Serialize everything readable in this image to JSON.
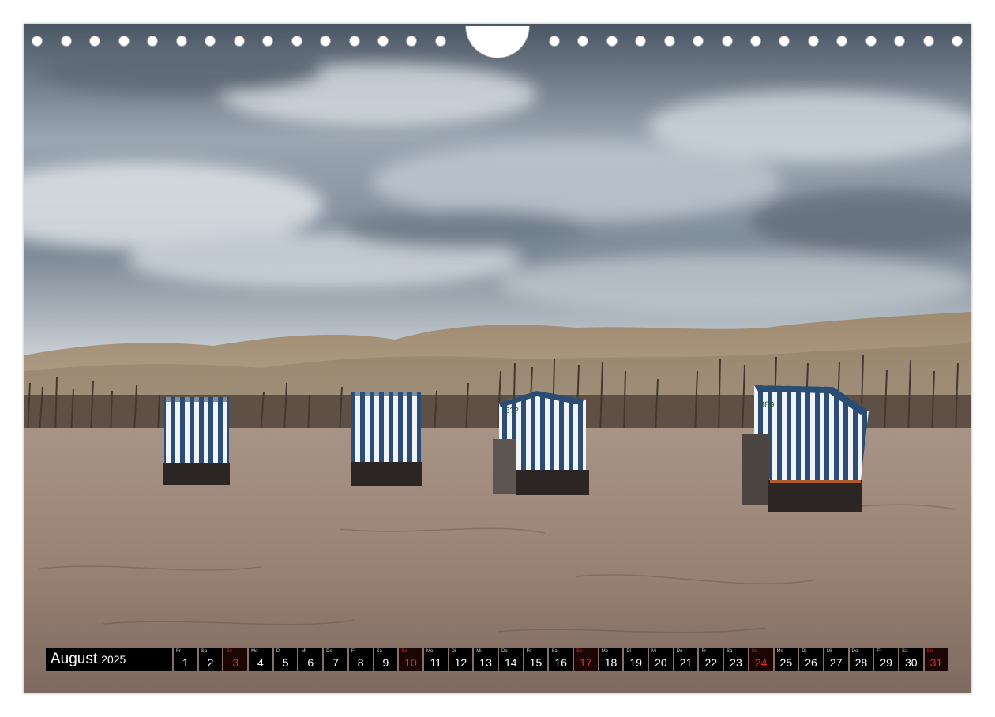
{
  "calendar": {
    "month": "August",
    "year": "2025",
    "sunday_color": "#e0301e",
    "days": [
      {
        "dow": "Fr",
        "num": "1",
        "sunday": false
      },
      {
        "dow": "Sa",
        "num": "2",
        "sunday": false
      },
      {
        "dow": "So",
        "num": "3",
        "sunday": true
      },
      {
        "dow": "Mo",
        "num": "4",
        "sunday": false
      },
      {
        "dow": "Di",
        "num": "5",
        "sunday": false
      },
      {
        "dow": "Mi",
        "num": "6",
        "sunday": false
      },
      {
        "dow": "Do",
        "num": "7",
        "sunday": false
      },
      {
        "dow": "Fr",
        "num": "8",
        "sunday": false
      },
      {
        "dow": "Sa",
        "num": "9",
        "sunday": false
      },
      {
        "dow": "So",
        "num": "10",
        "sunday": true
      },
      {
        "dow": "Mo",
        "num": "11",
        "sunday": false
      },
      {
        "dow": "Di",
        "num": "12",
        "sunday": false
      },
      {
        "dow": "Mi",
        "num": "13",
        "sunday": false
      },
      {
        "dow": "Do",
        "num": "14",
        "sunday": false
      },
      {
        "dow": "Fr",
        "num": "15",
        "sunday": false
      },
      {
        "dow": "Sa",
        "num": "16",
        "sunday": false
      },
      {
        "dow": "So",
        "num": "17",
        "sunday": true
      },
      {
        "dow": "Mo",
        "num": "18",
        "sunday": false
      },
      {
        "dow": "Di",
        "num": "19",
        "sunday": false
      },
      {
        "dow": "Mi",
        "num": "20",
        "sunday": false
      },
      {
        "dow": "Do",
        "num": "21",
        "sunday": false
      },
      {
        "dow": "Fr",
        "num": "22",
        "sunday": false
      },
      {
        "dow": "Sa",
        "num": "23",
        "sunday": false
      },
      {
        "dow": "So",
        "num": "24",
        "sunday": true
      },
      {
        "dow": "Mo",
        "num": "25",
        "sunday": false
      },
      {
        "dow": "Di",
        "num": "26",
        "sunday": false
      },
      {
        "dow": "Mi",
        "num": "27",
        "sunday": false
      },
      {
        "dow": "Do",
        "num": "28",
        "sunday": false
      },
      {
        "dow": "Fr",
        "num": "29",
        "sunday": false
      },
      {
        "dow": "Sa",
        "num": "30",
        "sunday": false
      },
      {
        "dow": "So",
        "num": "31",
        "sunday": true
      }
    ]
  },
  "photo": {
    "subject": "beach-chairs-dunes",
    "chair_numbers": [
      "",
      "",
      "6??",
      "389"
    ]
  }
}
